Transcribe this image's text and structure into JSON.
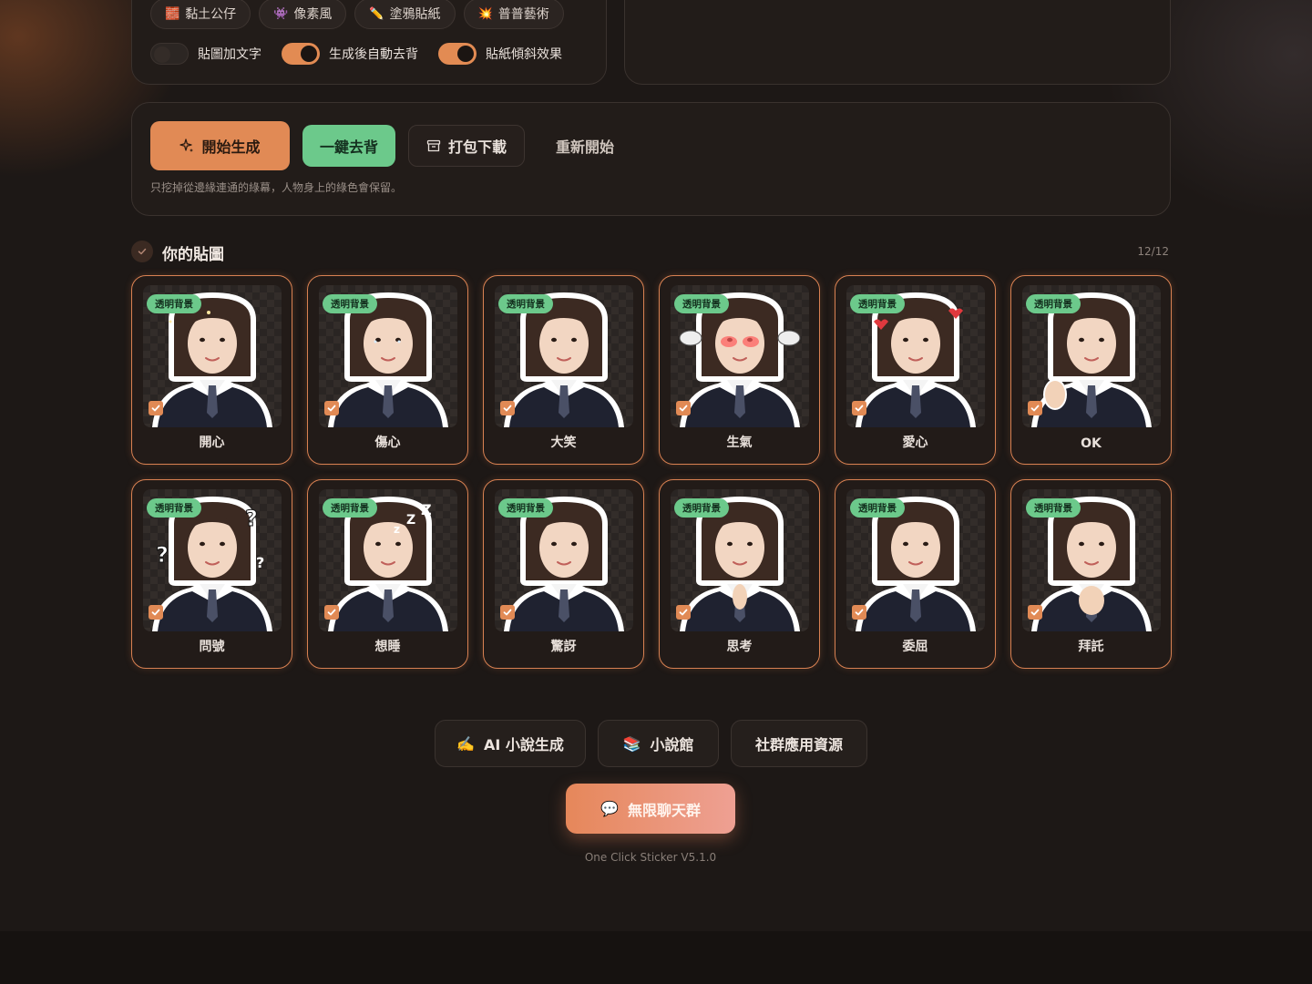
{
  "style_chips": [
    {
      "icon": "🧱",
      "label": "黏土公仔"
    },
    {
      "icon": "👾",
      "label": "像素風"
    },
    {
      "icon": "✏️",
      "label": "塗鴉貼紙"
    },
    {
      "icon": "💥",
      "label": "普普藝術"
    }
  ],
  "toggles": [
    {
      "label": "貼圖加文字",
      "on": false
    },
    {
      "label": "生成後自動去背",
      "on": true
    },
    {
      "label": "貼紙傾斜效果",
      "on": true
    }
  ],
  "actions": {
    "generate_label": "開始生成",
    "remove_bg_label": "一鍵去背",
    "download_label": "打包下載",
    "restart_label": "重新開始",
    "hint": "只挖掉從邊緣連通的綠幕，人物身上的綠色會保留。"
  },
  "gallery": {
    "title": "你的貼圖",
    "count": "12/12",
    "badge": "透明背景",
    "stickers": [
      {
        "label": "開心",
        "selected": true
      },
      {
        "label": "傷心",
        "selected": true
      },
      {
        "label": "大笑",
        "selected": true
      },
      {
        "label": "生氣",
        "selected": true
      },
      {
        "label": "愛心",
        "selected": true
      },
      {
        "label": "OK",
        "selected": true
      },
      {
        "label": "問號",
        "selected": true
      },
      {
        "label": "想睡",
        "selected": true
      },
      {
        "label": "驚訝",
        "selected": true
      },
      {
        "label": "思考",
        "selected": true
      },
      {
        "label": "委屈",
        "selected": true
      },
      {
        "label": "拜託",
        "selected": true
      }
    ]
  },
  "footer": {
    "links": [
      {
        "icon": "✍️",
        "label": "AI 小說生成"
      },
      {
        "icon": "📚",
        "label": "小說館"
      },
      {
        "icon": "",
        "label": "社群應用資源"
      }
    ],
    "chat_icon": "💬",
    "chat_label": "無限聊天群",
    "version": "One Click Sticker V5.1.0"
  },
  "colors": {
    "accent": "#e18a55",
    "success": "#6cc98b",
    "background": "#1d1816"
  }
}
